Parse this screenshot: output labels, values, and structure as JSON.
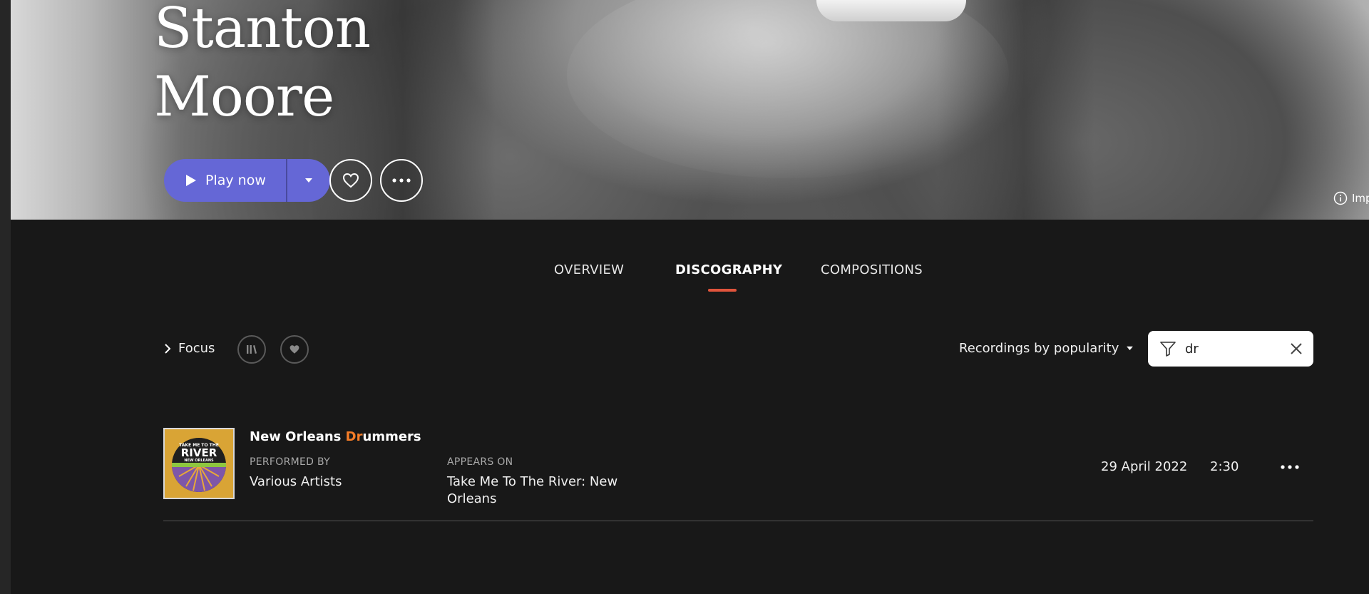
{
  "artist": {
    "name_line1": "Stanton",
    "name_line2": "Moore"
  },
  "actions": {
    "play_label": "Play now"
  },
  "hero": {
    "image_info_label": "Imp"
  },
  "tabs": [
    {
      "label": "OVERVIEW",
      "active": false
    },
    {
      "label": "DISCOGRAPHY",
      "active": true
    },
    {
      "label": "COMPOSITIONS",
      "active": false
    }
  ],
  "toolbar": {
    "focus_label": "Focus",
    "sort_label": "Recordings by popularity",
    "filter_value": "dr"
  },
  "tracks": [
    {
      "title_highlight": "Dr",
      "title_prefix": "New Orleans ",
      "title_suffix": "ummers",
      "performed_by_label": "PERFORMED BY",
      "performed_by": "Various Artists",
      "appears_on_label": "APPEARS ON",
      "appears_on_line1": "Take Me To The River: New",
      "appears_on_line2": "Orleans",
      "date": "29 April 2022",
      "duration": "2:30",
      "cover_text_top": "TAKE ME TO THE",
      "cover_text_main": "RIVER",
      "cover_text_sub": "NEW ORLEANS"
    }
  ],
  "colors": {
    "accent_play": "#6567d6",
    "tab_underline": "#e0543c",
    "highlight": "#f57d28",
    "background": "#181818"
  },
  "icons": [
    "play-icon",
    "chevron-down-icon",
    "heart-icon",
    "more-icon",
    "info-icon",
    "chevron-right-icon",
    "library-icon",
    "filter-icon",
    "close-icon"
  ]
}
